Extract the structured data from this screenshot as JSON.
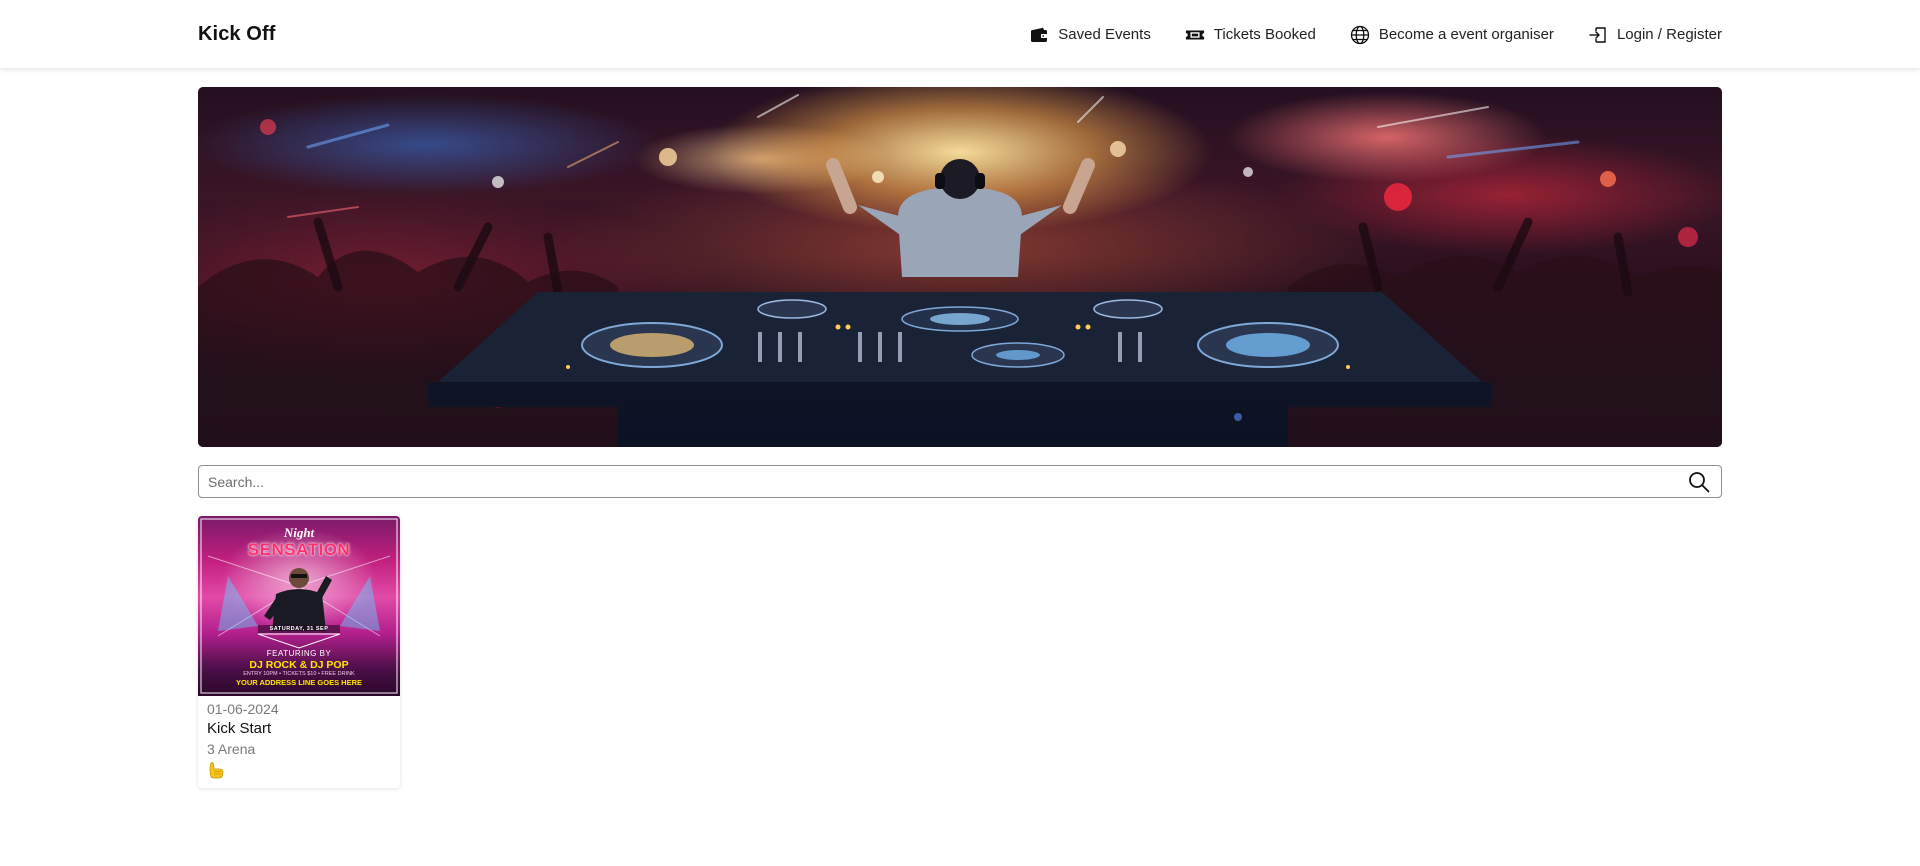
{
  "nav": {
    "brand": "Kick Off",
    "links": [
      {
        "label": "Saved Events",
        "icon": "wallet-icon"
      },
      {
        "label": "Tickets Booked",
        "icon": "ticket-icon"
      },
      {
        "label": "Become a event organiser",
        "icon": "globe-icon"
      },
      {
        "label": "Login / Register",
        "icon": "login-icon"
      }
    ]
  },
  "hero": {
    "image": "dj-crowd-banner"
  },
  "search": {
    "placeholder": "Search...",
    "value": "",
    "icon": "search-icon"
  },
  "events": [
    {
      "date": "01-06-2024",
      "title": "Kick Start",
      "venue": "3 Arena",
      "like_icon": "thumbs-up-icon",
      "poster": {
        "night": "Night",
        "headline": "SENSATION",
        "date_line": "SATURDAY, 31 SEP",
        "featuring": "FEATURING BY",
        "djs": "DJ ROCK & DJ POP",
        "entry": "ENTRY 10PM • TICKETS $10 • FREE DRINK",
        "address": "YOUR ADDRESS LINE GOES HERE"
      }
    }
  ],
  "colors": {
    "like": "#f5c518",
    "poster_pink": "#e24aa8",
    "poster_yellow": "#ffe600"
  }
}
